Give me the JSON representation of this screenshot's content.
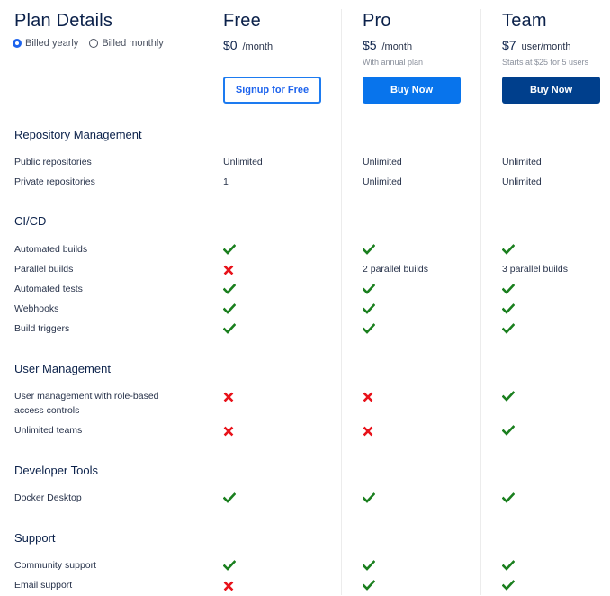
{
  "header": {
    "title": "Plan Details",
    "billing_options": [
      {
        "label": "Billed yearly",
        "selected": true
      },
      {
        "label": "Billed monthly",
        "selected": false
      }
    ]
  },
  "plans": [
    {
      "name": "Free",
      "price": "$0",
      "unit": "/month",
      "note": "",
      "button": "Signup for Free"
    },
    {
      "name": "Pro",
      "price": "$5",
      "unit": "/month",
      "note": "With annual plan",
      "button": "Buy Now"
    },
    {
      "name": "Team",
      "price": "$7",
      "unit": "user/month",
      "note": "Starts at $25 for 5 users",
      "button": "Buy Now"
    }
  ],
  "colors": {
    "check": "#1a7f1e",
    "cross": "#e8121a",
    "primary_blue": "#0874ec",
    "navy": "#003f8c"
  },
  "sections": [
    {
      "title": "Repository Management",
      "features": [
        {
          "label": "Public repositories",
          "values": [
            "Unlimited",
            "Unlimited",
            "Unlimited"
          ]
        },
        {
          "label": "Private repositories",
          "values": [
            "1",
            "Unlimited",
            "Unlimited"
          ]
        }
      ]
    },
    {
      "title": "CI/CD",
      "features": [
        {
          "label": "Automated builds",
          "values": [
            "check",
            "check",
            "check"
          ]
        },
        {
          "label": "Parallel builds",
          "values": [
            "cross",
            "2 parallel builds",
            "3 parallel builds"
          ]
        },
        {
          "label": "Automated tests",
          "values": [
            "check",
            "check",
            "check"
          ]
        },
        {
          "label": "Webhooks",
          "values": [
            "check",
            "check",
            "check"
          ]
        },
        {
          "label": "Build triggers",
          "values": [
            "check",
            "check",
            "check"
          ]
        }
      ]
    },
    {
      "title": "User Management",
      "features": [
        {
          "label": "User management with role-based access controls",
          "values": [
            "cross",
            "cross",
            "check"
          ]
        },
        {
          "label": "Unlimited teams",
          "values": [
            "cross",
            "cross",
            "check"
          ]
        }
      ]
    },
    {
      "title": "Developer Tools",
      "features": [
        {
          "label": "Docker Desktop",
          "values": [
            "check",
            "check",
            "check"
          ]
        }
      ]
    },
    {
      "title": "Support",
      "features": [
        {
          "label": "Community support",
          "values": [
            "check",
            "check",
            "check"
          ]
        },
        {
          "label": "Email support",
          "values": [
            "cross",
            "check",
            "check"
          ]
        }
      ]
    }
  ]
}
